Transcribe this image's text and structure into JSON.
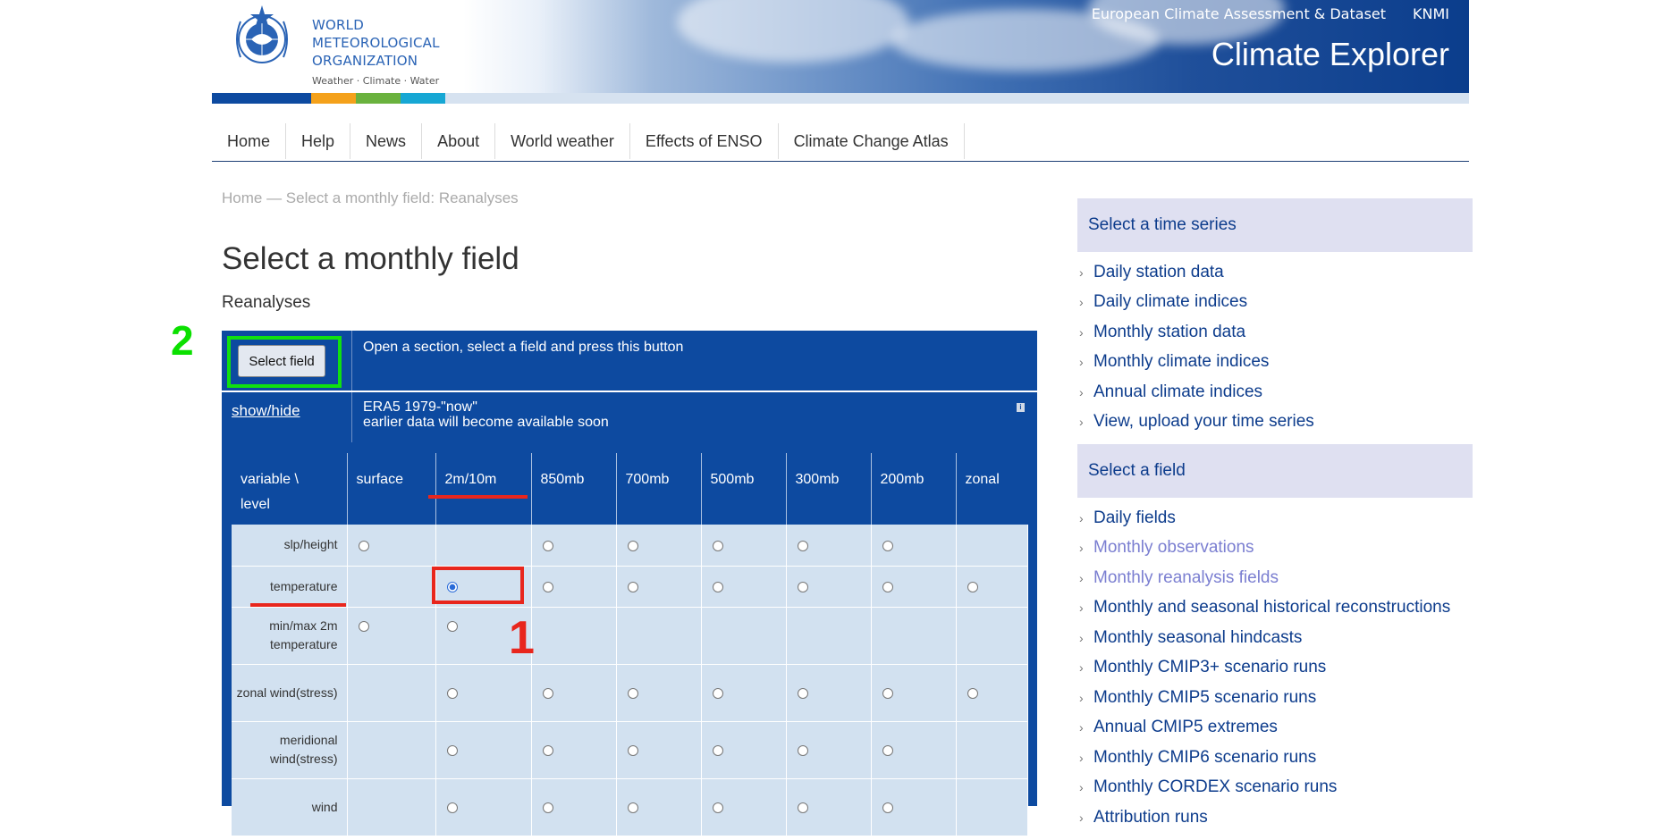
{
  "banner": {
    "org_name_lines": [
      "WORLD",
      "METEOROLOGICAL",
      "ORGANIZATION"
    ],
    "tagline": "Weather · Climate · Water",
    "top_links": [
      "European Climate Assessment & Dataset",
      "KNMI"
    ],
    "site_title": "Climate Explorer",
    "color_bar": [
      "#0d4aa0",
      "#f4a11b",
      "#6ab23e",
      "#16a7d4"
    ]
  },
  "nav": {
    "items": [
      "Home",
      "Help",
      "News",
      "About",
      "World weather",
      "Effects of ENSO",
      "Climate Change Atlas"
    ]
  },
  "breadcrumb": "Home — Select a monthly field: Reanalyses",
  "page": {
    "title": "Select a monthly field",
    "subtitle": "Reanalyses"
  },
  "panel": {
    "select_button": "Select field",
    "select_hint": "Open a section, select a field and press this button",
    "show_hide": "show/hide",
    "dataset_line1": "ERA5 1979-\"now\"",
    "dataset_line2": "earlier data will become available soon",
    "info_icon": "i"
  },
  "table": {
    "columns": [
      "variable \\ level",
      "surface",
      "2m/10m",
      "850mb",
      "700mb",
      "500mb",
      "300mb",
      "200mb",
      "zonal"
    ],
    "rows": [
      {
        "label": "slp/height",
        "radios": [
          1,
          0,
          1,
          1,
          1,
          1,
          1,
          0
        ]
      },
      {
        "label": "temperature",
        "radios": [
          0,
          2,
          1,
          1,
          1,
          1,
          1,
          1
        ]
      },
      {
        "label": "min/max 2m temperature",
        "radios": [
          1,
          1,
          0,
          0,
          0,
          0,
          0,
          0
        ]
      },
      {
        "label": "zonal wind(stress)",
        "radios": [
          0,
          1,
          1,
          1,
          1,
          1,
          1,
          1
        ]
      },
      {
        "label": "meridional wind(stress)",
        "radios": [
          0,
          1,
          1,
          1,
          1,
          1,
          1,
          0
        ]
      },
      {
        "label": "wind",
        "radios": [
          0,
          1,
          1,
          1,
          1,
          1,
          1,
          0
        ]
      }
    ]
  },
  "sidebar": {
    "time_series_heading": "Select a time series",
    "time_series_items": [
      "Daily station data",
      "Daily climate indices",
      "Monthly station data",
      "Monthly climate indices",
      "Annual climate indices",
      "View, upload your time series"
    ],
    "field_heading": "Select a field",
    "field_items": [
      {
        "label": "Daily fields",
        "visited": false
      },
      {
        "label": "Monthly observations",
        "visited": true
      },
      {
        "label": "Monthly reanalysis fields",
        "visited": true
      },
      {
        "label": "Monthly and seasonal historical reconstructions",
        "visited": false
      },
      {
        "label": "Monthly seasonal hindcasts",
        "visited": false
      },
      {
        "label": "Monthly CMIP3+ scenario runs",
        "visited": false
      },
      {
        "label": "Monthly CMIP5 scenario runs",
        "visited": false
      },
      {
        "label": "Annual CMIP5 extremes",
        "visited": false
      },
      {
        "label": "Monthly CMIP6 scenario runs",
        "visited": false
      },
      {
        "label": "Monthly CORDEX scenario runs",
        "visited": false
      },
      {
        "label": "Attribution runs",
        "visited": false
      }
    ]
  },
  "annotations": {
    "step_1": "1",
    "step_2": "2",
    "green": "#10e010",
    "red": "#e8261d"
  }
}
